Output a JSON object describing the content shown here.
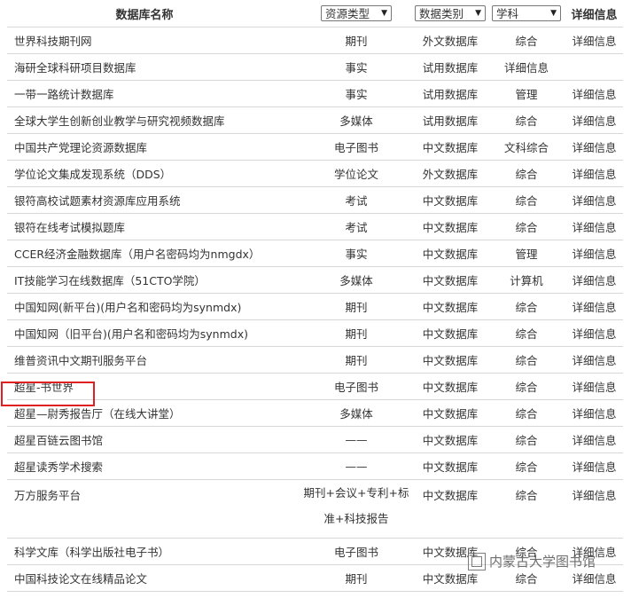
{
  "header": {
    "name": "数据库名称",
    "type_filter": "资源类型",
    "category_filter": "数据类别",
    "subject_filter": "学科",
    "detail": "详细信息"
  },
  "rows": [
    {
      "name": "世界科技期刊网",
      "type": "期刊",
      "category": "外文数据库",
      "subject": "综合",
      "detail": "详细信息"
    },
    {
      "name": "海研全球科研项目数据库",
      "type": "事实",
      "category": "试用数据库",
      "subject": "详细信息",
      "detail": ""
    },
    {
      "name": "一带一路统计数据库",
      "type": "事实",
      "category": "试用数据库",
      "subject": "管理",
      "detail": "详细信息"
    },
    {
      "name": "全球大学生创新创业教学与研究视频数据库",
      "type": "多媒体",
      "category": "试用数据库",
      "subject": "综合",
      "detail": "详细信息"
    },
    {
      "name": "中国共产党理论资源数据库",
      "type": "电子图书",
      "category": "中文数据库",
      "subject": "文科综合",
      "detail": "详细信息"
    },
    {
      "name": "学位论文集成发现系统（DDS）",
      "type": "学位论文",
      "category": "外文数据库",
      "subject": "综合",
      "detail": "详细信息"
    },
    {
      "name": "银符高校试题素材资源库应用系统",
      "type": "考试",
      "category": "中文数据库",
      "subject": "综合",
      "detail": "详细信息"
    },
    {
      "name": "银符在线考试模拟题库",
      "type": "考试",
      "category": "中文数据库",
      "subject": "综合",
      "detail": "详细信息"
    },
    {
      "name": "CCER经济金融数据库（用户名密码均为nmgdx）",
      "type": "事实",
      "category": "中文数据库",
      "subject": "管理",
      "detail": "详细信息"
    },
    {
      "name": "IT技能学习在线数据库（51CTO学院）",
      "type": "多媒体",
      "category": "中文数据库",
      "subject": "计算机",
      "detail": "详细信息"
    },
    {
      "name": "中国知网(新平台)(用户名和密码均为synmdx)",
      "type": "期刊",
      "category": "中文数据库",
      "subject": "综合",
      "detail": "详细信息"
    },
    {
      "name": "中国知网（旧平台)(用户名和密码均为synmdx)",
      "type": "期刊",
      "category": "中文数据库",
      "subject": "综合",
      "detail": "详细信息"
    },
    {
      "name": "维普资讯中文期刊服务平台",
      "type": "期刊",
      "category": "中文数据库",
      "subject": "综合",
      "detail": "详细信息"
    },
    {
      "name": "超星-书世界",
      "type": "电子图书",
      "category": "中文数据库",
      "subject": "综合",
      "detail": "详细信息"
    },
    {
      "name": "超星—尉秀报告厅（在线大讲堂）",
      "type": "多媒体",
      "category": "中文数据库",
      "subject": "综合",
      "detail": "详细信息"
    },
    {
      "name": "超星百链云图书馆",
      "type": "——",
      "category": "中文数据库",
      "subject": "综合",
      "detail": "详细信息"
    },
    {
      "name": "超星读秀学术搜索",
      "type": "——",
      "category": "中文数据库",
      "subject": "综合",
      "detail": "详细信息"
    },
    {
      "name": "万方服务平台",
      "type": "期刊+会议+专利+标准+科技报告",
      "category": "中文数据库",
      "subject": "综合",
      "detail": "详细信息",
      "wrap": true
    },
    {
      "name": "科学文库（科学出版社电子书）",
      "type": "电子图书",
      "category": "中文数据库",
      "subject": "综合",
      "detail": "详细信息"
    },
    {
      "name": "中国科技论文在线精品论文",
      "type": "期刊",
      "category": "中文数据库",
      "subject": "综合",
      "detail": "详细信息"
    }
  ],
  "watermark": "内蒙古大学图书馆"
}
